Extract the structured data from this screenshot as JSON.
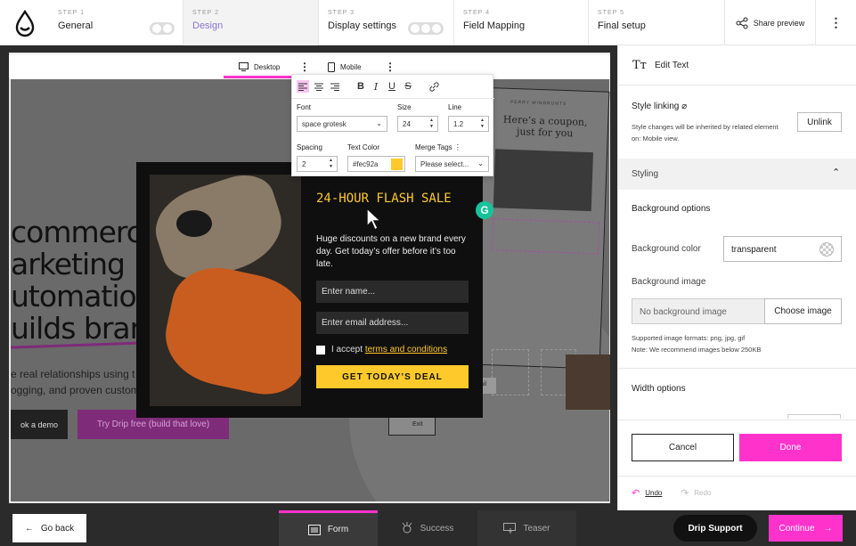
{
  "steps": [
    {
      "num": "STEP 1",
      "label": "General"
    },
    {
      "num": "STEP 2",
      "label": "Design"
    },
    {
      "num": "STEP 3",
      "label": "Display settings"
    },
    {
      "num": "STEP 4",
      "label": "Field Mapping"
    },
    {
      "num": "STEP 5",
      "label": "Final setup"
    }
  ],
  "share_label": "Share preview",
  "device_tabs": {
    "desktop": "Desktop",
    "mobile": "Mobile"
  },
  "site": {
    "hero_lines": [
      "commerce",
      "arketing",
      "utomation",
      "uilds brand"
    ],
    "sub_lines": [
      "e real relationships using t",
      "ogging, and proven custom"
    ],
    "demo_button": "ok a demo",
    "try_button": "Try Drip free (build that love)",
    "card_brand": "PERRY MINDRUNTS",
    "card_text": "Here’s a coupon, just for you",
    "exit_label": "Exit",
    "email_label": "ail"
  },
  "popup": {
    "title": "24-HOUR FLASH SALE",
    "body": "Huge discounts on a new brand every day. Get today’s offer before it’s too late.",
    "name_placeholder": "Enter name...",
    "email_placeholder": "Enter email address...",
    "consent_text": "I accept ",
    "consent_link": "terms and conditions",
    "cta": "GET TODAY’S DEAL"
  },
  "toolbar": {
    "font_label": "Font",
    "font_value": "space grotesk",
    "size_label": "Size",
    "size_value": "24",
    "line_label": "Line",
    "line_value": "1.2",
    "spacing_label": "Spacing",
    "spacing_value": "2",
    "color_label": "Text Color",
    "color_value": "#fec92a",
    "merge_label": "Merge Tags",
    "merge_placeholder": "Please select..."
  },
  "panel": {
    "title": "Edit Text",
    "style_linking": "Style linking",
    "style_linking_note": "Style changes will be inherited by related element on: Mobile view.",
    "unlink": "Unlink",
    "styling": "Styling",
    "bg_options": "Background options",
    "bg_color_label": "Background color",
    "bg_color_value": "transparent",
    "bg_image_label": "Background image",
    "no_bg_image": "No background image",
    "choose_image": "Choose image",
    "formats_note": "Supported image formats: png, jpg, gif",
    "size_note": "Note: We recommend images below 250KB",
    "width_options": "Width options",
    "cancel": "Cancel",
    "done": "Done",
    "undo": "Undo",
    "redo": "Redo"
  },
  "bottom": {
    "go_back": "Go back",
    "tabs": [
      "Form",
      "Success",
      "Teaser"
    ],
    "support": "Drip Support",
    "continue": "Continue"
  },
  "colors": {
    "accent": "#ff33cc",
    "brand_yellow": "#fec92a",
    "design_step": "#8a74d4"
  },
  "icons": [
    "drip-logo-icon",
    "share-icon",
    "kebab-icon",
    "desktop-icon",
    "mobile-icon",
    "align-left-icon",
    "align-center-icon",
    "align-right-icon",
    "bold-icon",
    "italic-icon",
    "underline-icon",
    "strikethrough-icon",
    "link-icon",
    "text-format-icon",
    "paperclip-icon",
    "chevron-up-icon",
    "checker-icon",
    "undo-icon",
    "redo-icon",
    "arrow-left-icon",
    "arrow-right-icon",
    "form-icon",
    "success-icon",
    "teaser-icon"
  ]
}
